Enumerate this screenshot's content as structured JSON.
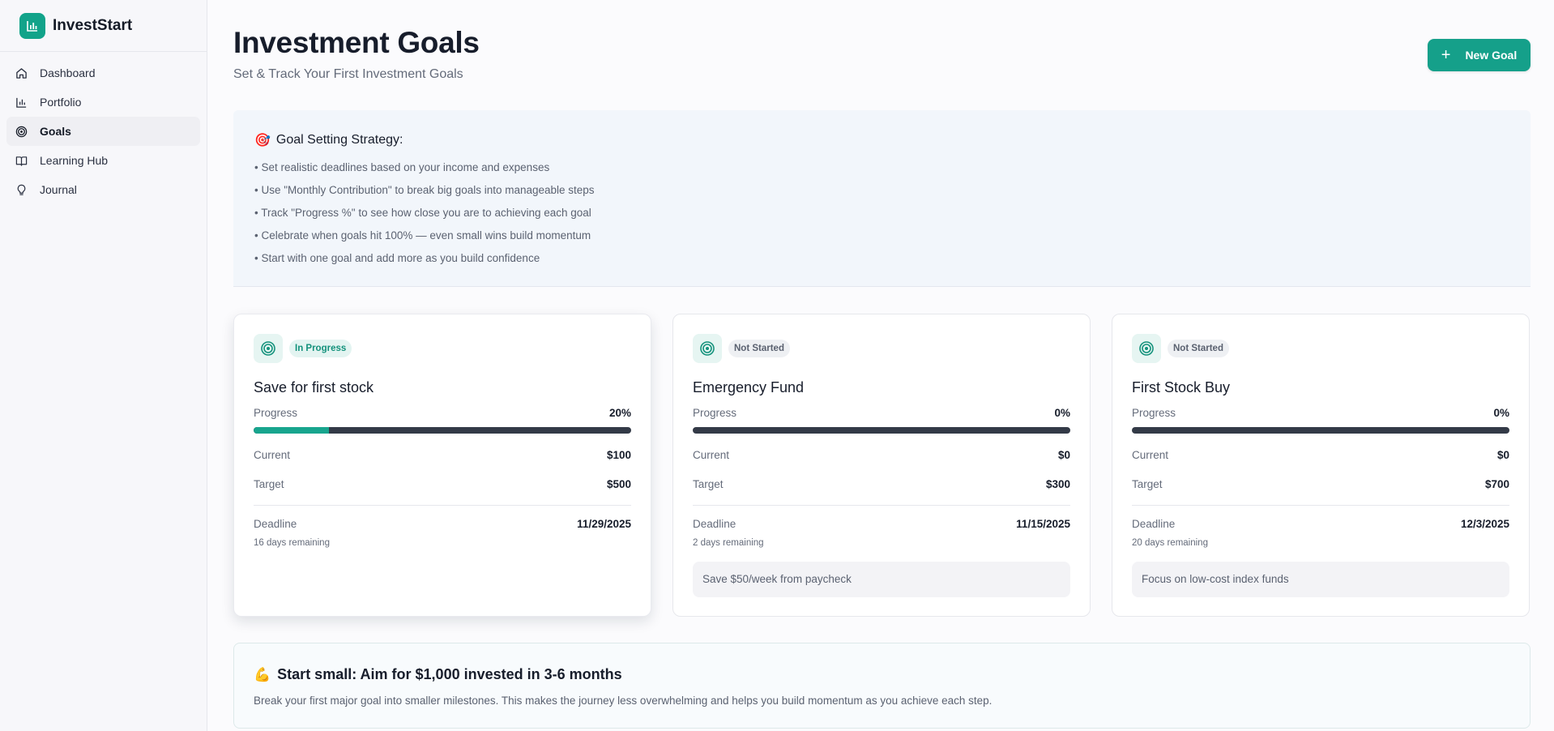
{
  "app": {
    "name": "InvestStart",
    "logo_icon": "bar-chart-icon",
    "accent": "#12a38a"
  },
  "sidebar": {
    "items": [
      {
        "label": "Dashboard",
        "icon": "home-icon",
        "active": false
      },
      {
        "label": "Portfolio",
        "icon": "bar-chart-icon",
        "active": false
      },
      {
        "label": "Goals",
        "icon": "target-icon",
        "active": true
      },
      {
        "label": "Learning Hub",
        "icon": "book-icon",
        "active": false
      },
      {
        "label": "Journal",
        "icon": "lightbulb-icon",
        "active": false
      }
    ]
  },
  "header": {
    "title": "Investment Goals",
    "subtitle": "Set & Track Your First Investment Goals",
    "new_goal_label": "New Goal"
  },
  "strategy": {
    "emoji": "🎯",
    "title": "Goal Setting Strategy:",
    "items": [
      "• Set realistic deadlines based on your income and expenses",
      "• Use \"Monthly Contribution\" to break big goals into manageable steps",
      "• Track \"Progress %\" to see how close you are to achieving each goal",
      "• Celebrate when goals hit 100% — even small wins build momentum",
      "• Start with one goal and add more as you build confidence"
    ]
  },
  "labels": {
    "progress": "Progress",
    "current": "Current",
    "target": "Target",
    "deadline": "Deadline"
  },
  "goals": [
    {
      "status": "In Progress",
      "title": "Save for first stock",
      "progress_text": "20%",
      "progress_fraction": 0.2,
      "current": "$100",
      "target": "$500",
      "deadline": "11/29/2025",
      "remaining": "16 days remaining",
      "note": ""
    },
    {
      "status": "Not Started",
      "title": "Emergency Fund",
      "progress_text": "0%",
      "progress_fraction": 0,
      "current": "$0",
      "target": "$300",
      "deadline": "11/15/2025",
      "remaining": "2 days remaining",
      "note": "Save $50/week from paycheck"
    },
    {
      "status": "Not Started",
      "title": "First Stock Buy",
      "progress_text": "0%",
      "progress_fraction": 0,
      "current": "$0",
      "target": "$700",
      "deadline": "12/3/2025",
      "remaining": "20 days remaining",
      "note": "Focus on low-cost index funds"
    }
  ],
  "tip": {
    "emoji": "💪",
    "title": "Start small: Aim for $1,000 invested in 3-6 months",
    "text": "Break your first major goal into smaller milestones. This makes the journey less overwhelming and helps you build momentum as you achieve each step."
  }
}
